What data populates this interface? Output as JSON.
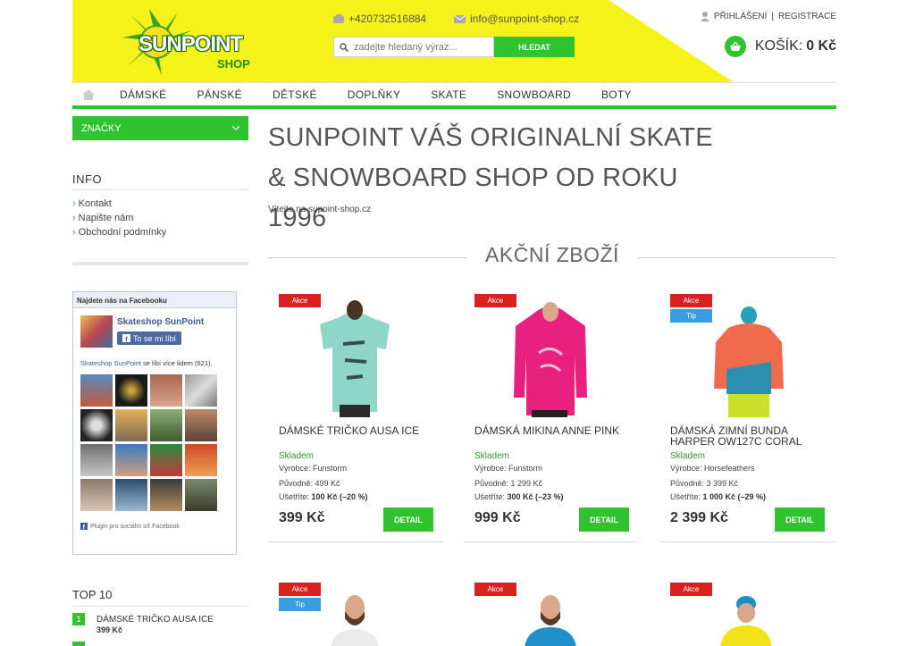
{
  "header": {
    "logo_text": "SUNPOINT",
    "logo_sub": "SHOP",
    "phone": "+420732516884",
    "email": "info@sunpoint-shop.cz",
    "search_placeholder": "zadejte hledaný výraz...",
    "search_button": "HLEDAT",
    "login": "PŘIHLÁŠENÍ",
    "separator": "|",
    "register": "REGISTRACE",
    "cart_label": "KOŠÍK:",
    "cart_value": "0 Kč"
  },
  "nav": {
    "items": [
      "DÁMSKÉ",
      "PÁNSKÉ",
      "DĚTSKÉ",
      "DOPLŇKY",
      "SKATE",
      "SNOWBOARD",
      "BOTY"
    ]
  },
  "sidebar": {
    "brands": "ZNAČKY",
    "info_heading": "INFO",
    "links": [
      "Kontakt",
      "Napište nám",
      "Obchodní podmínky"
    ],
    "top10_heading": "TOP 10",
    "top1": {
      "rank": "1",
      "name": "DÁMSKÉ TRIČKO AUSA ICE",
      "price": "399 Kč"
    }
  },
  "facebook": {
    "header": "Najdete nás na Facebooku",
    "page_name": "Skateshop SunPoint",
    "like_button": "To se mi líbí",
    "count_name": "Skateshop SunPoint",
    "count_text": " se líbí více lidem (621).",
    "plugin": "Plugin pro sociální síť Facebook"
  },
  "main": {
    "title": "SUNPOINT VÁŠ ORIGINALNÍ SKATE & SNOWBOARD SHOP OD ROKU 1996",
    "welcome": "Vítejte na supoint-shop.cz",
    "sale_heading": "AKČNÍ ZBOŽÍ"
  },
  "products": [
    {
      "badge": "Akce",
      "name": "DÁMSKÉ TRIČKO AUSA ICE",
      "stock": "Skladem",
      "maker": "Výrobce: Funstorm",
      "orig": "Původně: 499 Kč",
      "save_label": "Ušetříte: ",
      "save": "100 Kč (–20 %)",
      "price": "399 Kč",
      "detail": "DETAIL"
    },
    {
      "badge": "Akce",
      "name": "DÁMSKÁ MIKINA ANNE PINK",
      "stock": "Skladem",
      "maker": "Výrobce: Funstorm",
      "orig": "Původně: 1 299 Kč",
      "save_label": "Ušetříte: ",
      "save": "300 Kč (–23 %)",
      "price": "999 Kč",
      "detail": "DETAIL"
    },
    {
      "badge": "Akce",
      "badge2": "Tip",
      "name": "DÁMSKÁ ZIMNÍ BUNDA HARPER OW127C CORAL",
      "stock": "Skladem",
      "maker": "Výrobce: Horsefeathers",
      "orig": "Původně: 3 399 Kč",
      "save_label": "Ušetříte: ",
      "save": "1 000 Kč (–29 %)",
      "price": "2 399 Kč",
      "detail": "DETAIL"
    }
  ],
  "products_row2": [
    {
      "badge": "Akce",
      "badge2": "Tip"
    },
    {
      "badge": "Akce"
    },
    {
      "badge": "Akce"
    }
  ],
  "colors": {
    "accent": "#2fc32f",
    "header_yellow": "#f5f21a",
    "sale_red": "#d9211f",
    "tip_blue": "#3a9de0"
  }
}
